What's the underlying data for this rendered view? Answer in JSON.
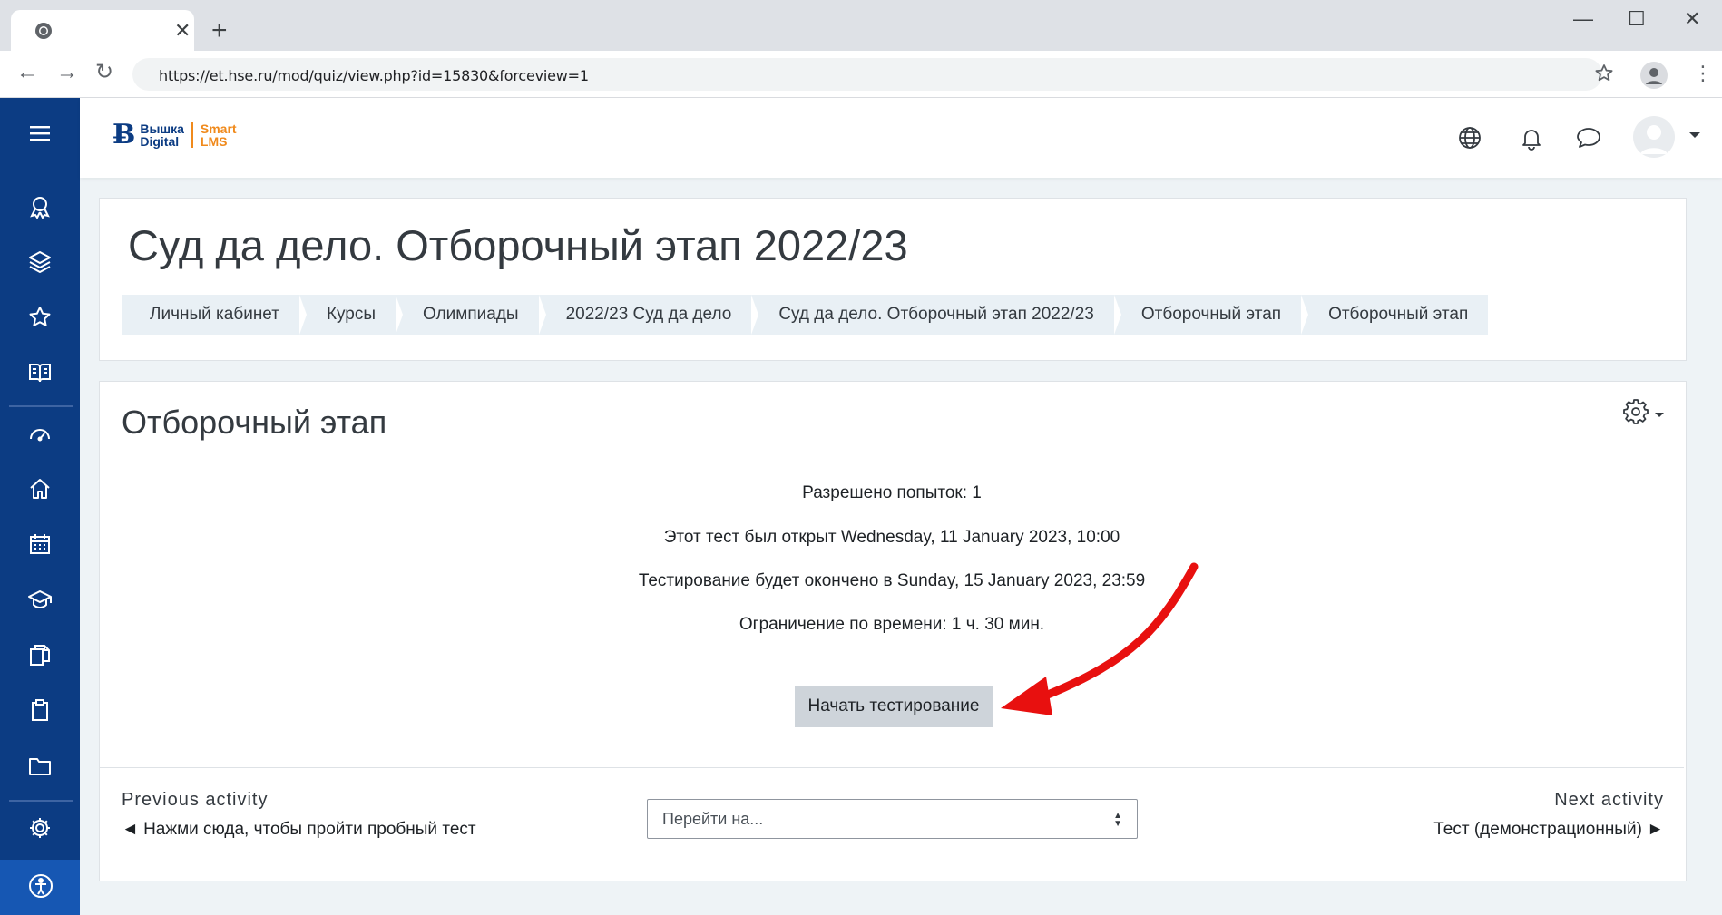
{
  "browser": {
    "tab": {
      "title": "",
      "close": "✕"
    },
    "new_tab": "+",
    "window": {
      "minimize": "—",
      "maximize": "☐",
      "close": "✕"
    },
    "url": "https://et.hse.ru/mod/quiz/view.php?id=15830&forceview=1"
  },
  "logo": {
    "line1": "Вышка",
    "line2": "Digital",
    "smart1": "Smart",
    "smart2": "LMS"
  },
  "sidebar": {
    "items": [
      "badges-icon",
      "layers-icon",
      "star-icon",
      "book-icon",
      "dashboard-icon",
      "home-icon",
      "calendar-icon",
      "graduation-icon",
      "files-icon",
      "clipboard-icon",
      "folder-icon",
      "settings-icon",
      "accessibility-icon"
    ]
  },
  "header": {
    "title": "Суд да дело. Отборочный этап 2022/23",
    "breadcrumb": [
      "Личный кабинет",
      "Курсы",
      "Олимпиады",
      "2022/23 Суд да дело",
      "Суд да дело. Отборочный этап 2022/23",
      "Отборочный этап",
      "Отборочный этап"
    ]
  },
  "quiz": {
    "title": "Отборочный этап",
    "attempts": "Разрешено попыток: 1",
    "opened": "Этот тест был открыт Wednesday, 11 January 2023, 10:00",
    "closes": "Тестирование будет окончено в Sunday, 15 January 2023, 23:59",
    "time_limit": "Ограничение по времени: 1 ч. 30 мин.",
    "start_button": "Начать тестирование"
  },
  "footer": {
    "prev_label": "Previous activity",
    "prev_link": "◄ Нажми сюда, чтобы пройти пробный тест",
    "jump_placeholder": "Перейти на...",
    "next_label": "Next activity",
    "next_link": "Тест (демонстрационный) ►"
  },
  "colors": {
    "sidebar": "#0c3c83",
    "accent_orange": "#f08a1c",
    "annotation_arrow": "#e8100f"
  }
}
